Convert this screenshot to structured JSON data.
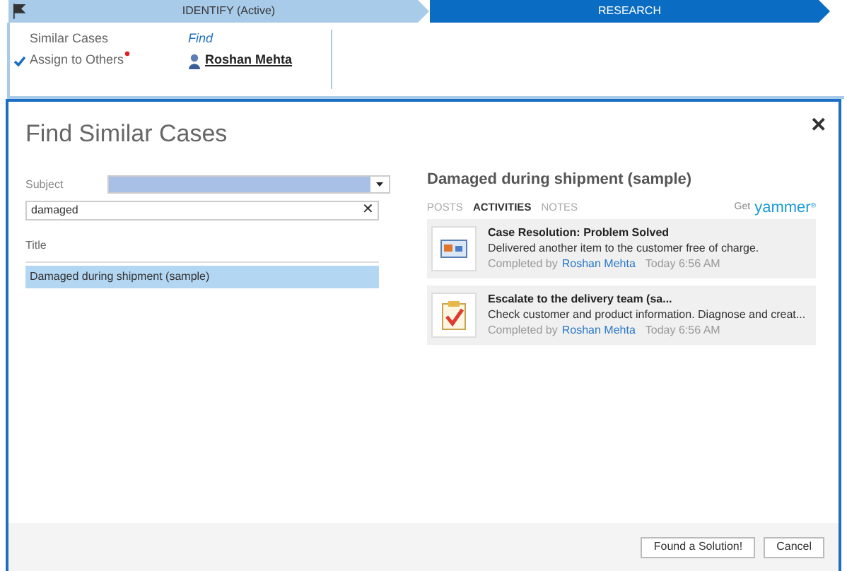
{
  "stages": [
    {
      "label": "IDENTIFY (Active)",
      "selected": false
    },
    {
      "label": "RESEARCH",
      "selected": true
    }
  ],
  "steps": [
    {
      "label": "Similar Cases",
      "checked": false,
      "required": false,
      "value": "Find",
      "kind": "link"
    },
    {
      "label": "Assign to Others",
      "checked": true,
      "required": true,
      "value": "Roshan Mehta",
      "kind": "user"
    }
  ],
  "dialog": {
    "title": "Find Similar Cases",
    "close": "✕",
    "subject": {
      "label": "Subject"
    },
    "search": {
      "value": "damaged",
      "clear": "✕"
    },
    "results": {
      "column": "Title",
      "rows": [
        {
          "text": "Damaged during shipment (sample)",
          "selected": true
        }
      ]
    },
    "detail": {
      "title": "Damaged during shipment (sample)",
      "tabs": [
        {
          "label": "POSTS",
          "selected": false
        },
        {
          "label": "ACTIVITIES",
          "selected": true
        },
        {
          "label": "NOTES",
          "selected": false
        }
      ],
      "get": "Get",
      "brand": "yammer",
      "brand_mark": "®",
      "activities": [
        {
          "kind": "resolution",
          "title": "Case Resolution: Problem Solved",
          "text": "Delivered another item to the customer free of charge.",
          "by": "Completed by",
          "user": "Roshan Mehta",
          "time": "Today 6:56 AM"
        },
        {
          "kind": "task",
          "title": "Escalate to the delivery team (sa...",
          "text": "Check customer and product information. Diagnose and creat...",
          "by": "Completed by",
          "user": "Roshan Mehta",
          "time": "Today 6:56 AM"
        }
      ]
    },
    "buttons": [
      "Found a Solution!",
      "Cancel"
    ]
  }
}
